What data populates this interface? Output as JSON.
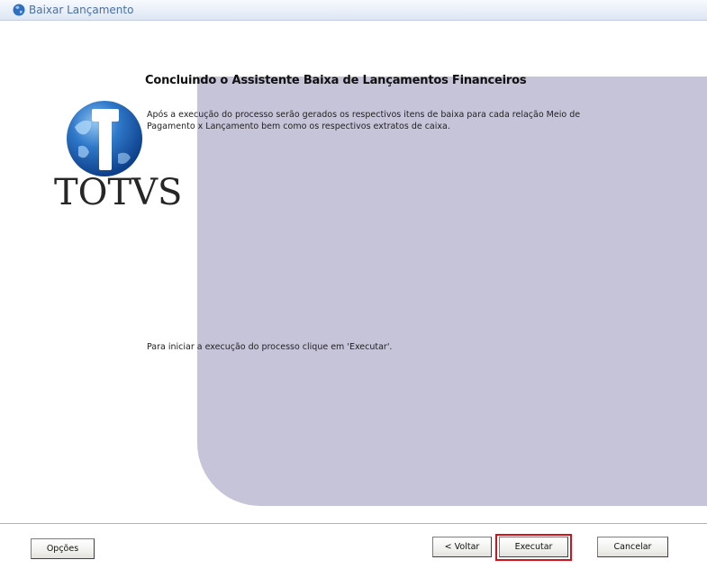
{
  "window": {
    "title": "Baixar Lançamento"
  },
  "logo": {
    "text": "TOTVS"
  },
  "wizard": {
    "title": "Concluindo o Assistente Baixa de Lançamentos Financeiros",
    "description_line1": "Após a execução do processo serão gerados os respectivos itens de baixa para cada relação Meio de",
    "description_line2": "Pagamento x Lançamento bem como os respectivos extratos de caixa.",
    "instruction": "Para iniciar a execução do processo clique em 'Executar'."
  },
  "footer": {
    "options_label": "Opções",
    "back_label": "< Voltar",
    "execute_label": "Executar",
    "cancel_label": "Cancelar"
  },
  "colors": {
    "panel": "#c6c4d9",
    "highlight": "#d1141c",
    "title_text": "#4a6fa5"
  }
}
